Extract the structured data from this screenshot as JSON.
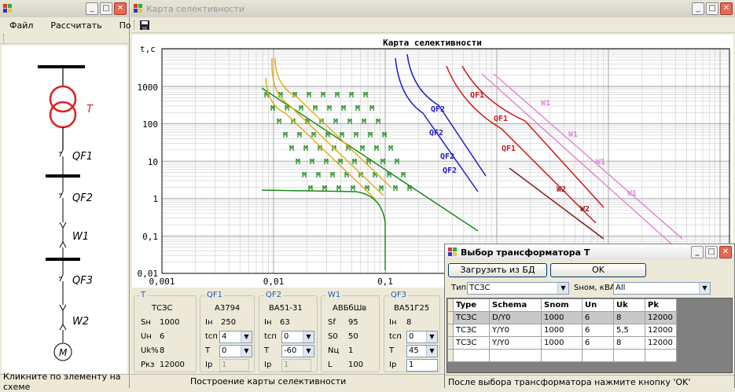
{
  "left_window": {
    "menu": [
      "Файл",
      "Рассчитать",
      "Помощь"
    ],
    "schema_labels": [
      "T",
      "QF1",
      "QF2",
      "W1",
      "QF3",
      "W2",
      "M"
    ],
    "status": "Кликните по элементу на схеме"
  },
  "main_window": {
    "title": "Карта селективности",
    "status": "Построение карты селективности",
    "chart": {
      "title": "Карта селективности",
      "ylabel": "t,c",
      "x_ticks": [
        "0,001",
        "0,01",
        "0,1"
      ],
      "y_ticks": [
        "1000",
        "100",
        "10",
        "1",
        "0,1",
        "0,01"
      ]
    },
    "groups": {
      "T": {
        "legend": "T",
        "name": "ТСЗС",
        "rows": [
          [
            "Sн",
            "1000"
          ],
          [
            "Uн",
            "6"
          ],
          [
            "Uk%",
            "8"
          ],
          [
            "Pкз",
            "12000"
          ]
        ]
      },
      "QF1": {
        "legend": "QF1",
        "name": "А3794",
        "in_label": "Iн",
        "in_value": "250",
        "tcn_label": "tсп",
        "tcn_value": "4",
        "t_label": "T",
        "t_value": "0",
        "ip_label": "Iр",
        "ip_value": "1"
      },
      "QF2": {
        "legend": "QF2",
        "name": "ВА51-31",
        "in_label": "Iн",
        "in_value": "63",
        "tcn_label": "tсп",
        "tcn_value": "0",
        "t_label": "T",
        "t_value": "-60",
        "ip_label": "Iр",
        "ip_value": "1"
      },
      "W1": {
        "legend": "W1",
        "name": "АВБбШв",
        "rows": [
          [
            "Sf",
            "95"
          ],
          [
            "S0",
            "50"
          ],
          [
            "Nц",
            "1"
          ],
          [
            "L",
            "100"
          ]
        ]
      },
      "QF3": {
        "legend": "QF3",
        "name": "ВА51Г25",
        "in_label": "Iн",
        "in_value": "8",
        "tcn_label": "tсп",
        "tcn_value": "0",
        "t_label": "T",
        "t_value": "45",
        "ip_label": "Iр",
        "ip_value": "1"
      }
    }
  },
  "dialog": {
    "title": "Выбор трансформатора T",
    "load_button": "Загрузить из БД",
    "ok_button": "OK",
    "type_label": "Тип",
    "type_value": "ТСЗС",
    "snom_label": "Sном, кВА",
    "snom_value": "All",
    "columns": [
      "Type",
      "Schema",
      "Snom",
      "Un",
      "Uk",
      "Pk"
    ],
    "rows": [
      [
        "ТСЗС",
        "D/Y0",
        "1000",
        "6",
        "8",
        "12000"
      ],
      [
        "ТСЗС",
        "Y/Y0",
        "1000",
        "6",
        "5,5",
        "12000"
      ],
      [
        "ТСЗС",
        "Y/Y0",
        "1000",
        "6",
        "8",
        "12000"
      ]
    ],
    "status": "После выбора трансформатора нажмите кнопку 'OK'"
  },
  "colors": {
    "green": "#1a8a1a",
    "yellow": "#e0b020",
    "blue": "#1a1acc",
    "red": "#cc1a1a",
    "darkred": "#8b1a1a",
    "pink": "#e08ad8",
    "transformer": "#e02020"
  }
}
